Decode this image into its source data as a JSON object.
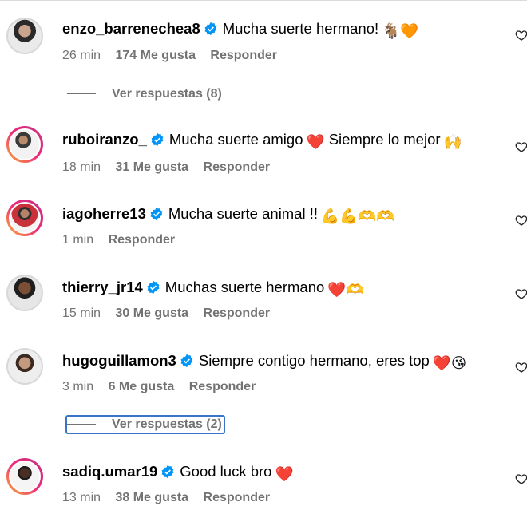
{
  "comments": [
    {
      "username": "enzo_barrenechea8",
      "text": "Mucha suerte hermano!",
      "emoji": "🐐🧡",
      "time": "26 min",
      "likes": "174 Me gusta",
      "reply": "Responder",
      "view_replies": "Ver respuestas (8)"
    },
    {
      "username": "ruboiranzo_",
      "text": "Mucha suerte amigo",
      "emoji": "❤️",
      "text2": "Siempre lo mejor",
      "emoji2": "🙌",
      "time": "18 min",
      "likes": "31 Me gusta",
      "reply": "Responder"
    },
    {
      "username": "iagoherre13",
      "text": "Mucha suerte animal !!",
      "emoji": "💪💪🫶🫶",
      "time": "1 min",
      "reply": "Responder"
    },
    {
      "username": "thierry_jr14",
      "text": "Muchas suerte hermano",
      "emoji": "❤️🫶",
      "time": "15 min",
      "likes": "30 Me gusta",
      "reply": "Responder"
    },
    {
      "username": "hugoguillamon3",
      "text": "Siempre contigo hermano, eres top",
      "emoji": "❤️😘",
      "time": "3 min",
      "likes": "6 Me gusta",
      "reply": "Responder",
      "view_replies": "Ver respuestas (2)"
    },
    {
      "username": "sadiq.umar19",
      "text": "Good luck bro",
      "emoji": "❤️",
      "time": "13 min",
      "likes": "38 Me gusta",
      "reply": "Responder"
    }
  ],
  "icons": {
    "verified": "verified-badge-icon",
    "like": "heart-outline-icon"
  },
  "colors": {
    "verified": "#0095f6",
    "meta": "#737373",
    "focus": "#3b74c6"
  }
}
